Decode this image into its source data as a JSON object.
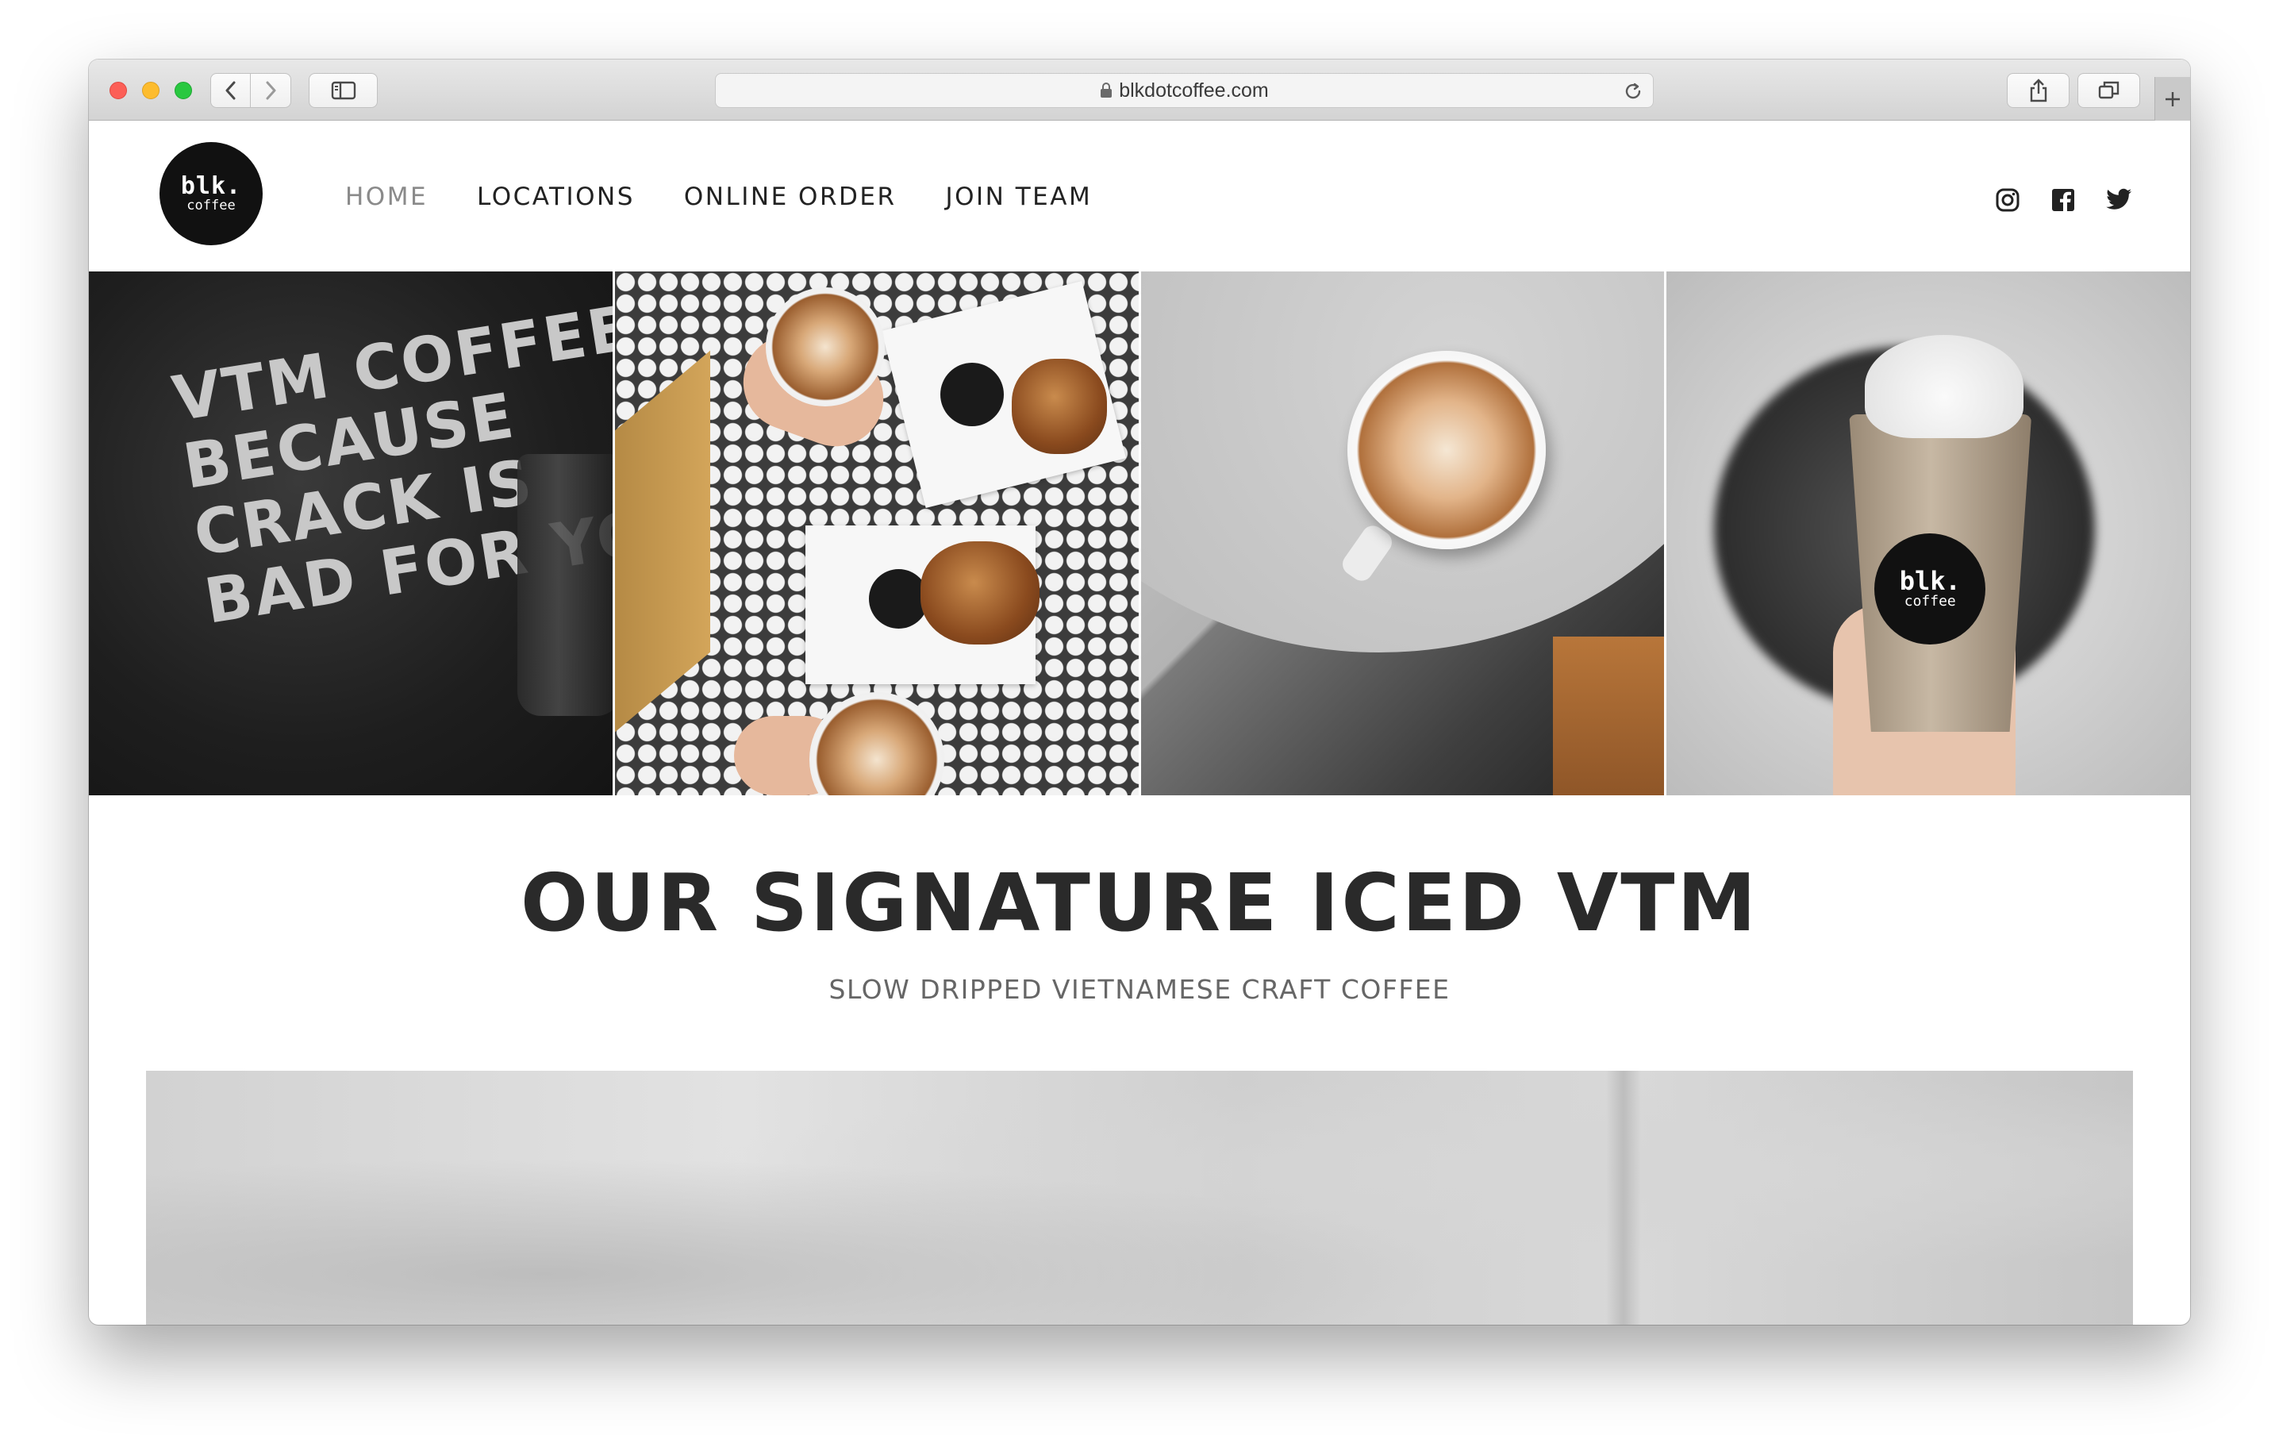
{
  "browser": {
    "url": "blkdotcoffee.com",
    "icons": {
      "back": "chevron-left-icon",
      "forward": "chevron-right-icon",
      "sidebar": "sidebar-icon",
      "lock": "lock-icon",
      "reload": "reload-icon",
      "share": "share-icon",
      "tabs": "tabs-overview-icon",
      "new_tab": "plus-icon"
    }
  },
  "site": {
    "logo": {
      "main": "blk.",
      "sub": "coffee"
    },
    "nav": [
      {
        "label": "HOME",
        "active": true
      },
      {
        "label": "LOCATIONS",
        "active": false
      },
      {
        "label": "ONLINE ORDER",
        "active": false
      },
      {
        "label": "JOIN TEAM",
        "active": false
      }
    ],
    "social": [
      "instagram-icon",
      "facebook-icon",
      "twitter-icon"
    ],
    "photos": {
      "tshirt_text": "VTM COFFEE\nBECAUSE\nCRACK IS\nBAD FOR YOU.",
      "cup_badge": {
        "main": "blk.",
        "sub": "coffee"
      }
    },
    "hero": {
      "title": "OUR SIGNATURE ICED VTM",
      "subtitle": "SLOW DRIPPED VIETNAMESE CRAFT COFFEE"
    }
  },
  "colors": {
    "text_dark": "#2a2a2a",
    "nav_active": "#8a8a8a",
    "logo_bg": "#111111"
  }
}
